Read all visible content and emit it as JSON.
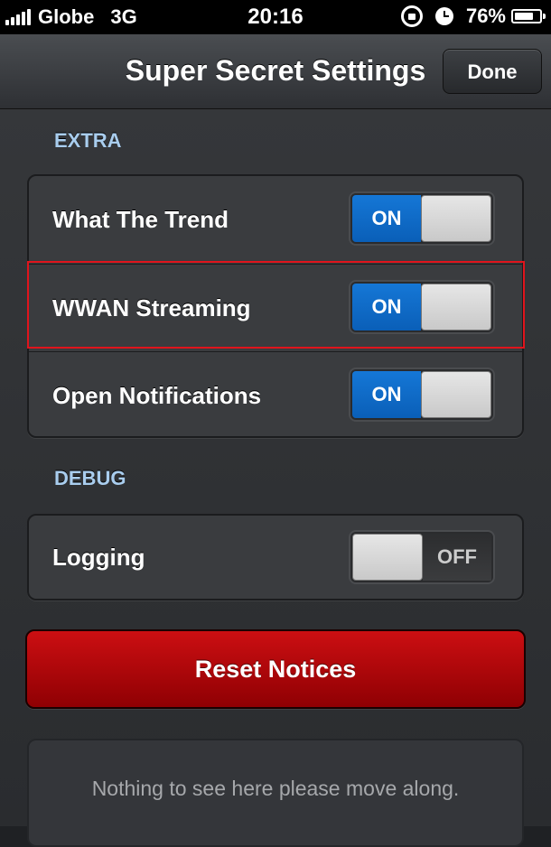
{
  "status_bar": {
    "carrier": "Globe",
    "network": "3G",
    "time": "20:16",
    "battery_percent": "76%",
    "battery_level": 0.76
  },
  "nav": {
    "title": "Super Secret Settings",
    "done_label": "Done"
  },
  "sections": [
    {
      "header": "EXTRA",
      "rows": [
        {
          "label": "What The Trend",
          "state": "ON"
        },
        {
          "label": "WWAN Streaming",
          "state": "ON",
          "highlighted": true
        },
        {
          "label": "Open Notifications",
          "state": "ON"
        }
      ]
    },
    {
      "header": "DEBUG",
      "rows": [
        {
          "label": "Logging",
          "state": "OFF"
        }
      ]
    }
  ],
  "reset_button_label": "Reset Notices",
  "footer_text": "Nothing to see here please move along.",
  "colors": {
    "toggle_on": "#1577d6",
    "section_header": "#a9cdee",
    "reset_button": "#cc0f12",
    "highlight": "#e0141c"
  }
}
